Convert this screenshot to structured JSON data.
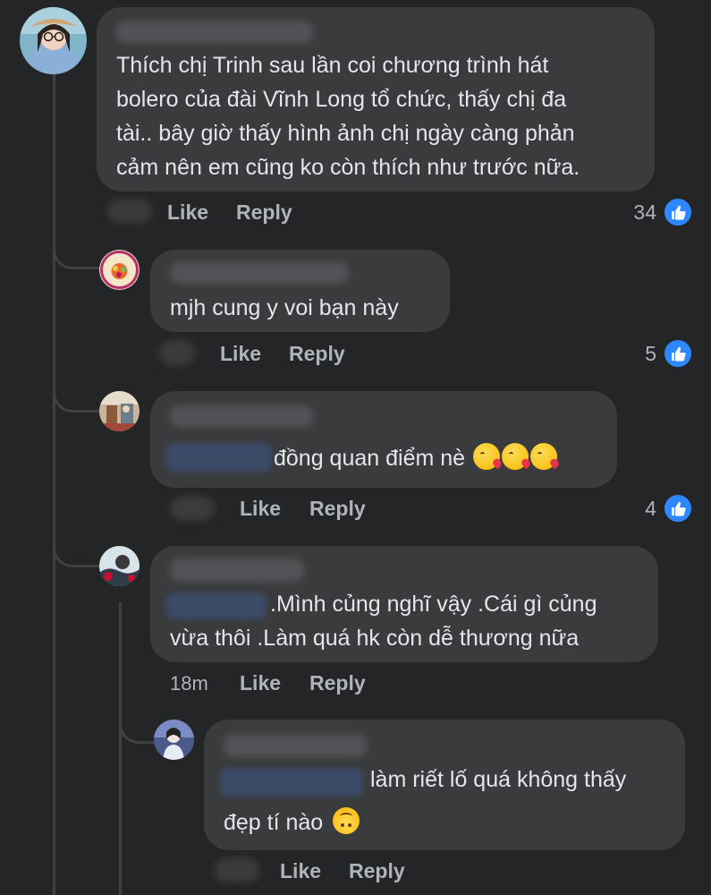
{
  "actions": {
    "like": "Like",
    "reply": "Reply"
  },
  "colors": {
    "like_blue": "#2d88ff",
    "bubble": "#3a3b3c",
    "background": "#242526"
  },
  "comments": [
    {
      "text_lines": [
        "Thích chị Trinh sau lần coi chương trình hát",
        "bolero của đài Vĩnh Long tổ chức, thấy chị đa",
        "tài.. bây giờ thấy hình ảnh chị ngày càng phản",
        "cảm nên em cũng ko còn thích như trước nữa."
      ],
      "like_count": "34"
    },
    {
      "text": "mjh cung y voi bạn này",
      "like_count": "5"
    },
    {
      "text": "đồng quan điểm nè",
      "emoji": [
        "kissing-heart-emoji",
        "kissing-heart-emoji",
        "kissing-heart-emoji"
      ],
      "like_count": "4"
    },
    {
      "text_lines": [
        ".Mình củng nghĩ vậy .Cái gì củng",
        "vừa thôi .Làm quá hk còn dễ thương nữa"
      ],
      "time": "18m"
    },
    {
      "text_lines": [
        "làm riết lố quá không thấy",
        "đẹp tí nào"
      ],
      "emoji": "upside-down-face-emoji"
    }
  ],
  "icons": {
    "like": "thumbs-up-icon"
  }
}
